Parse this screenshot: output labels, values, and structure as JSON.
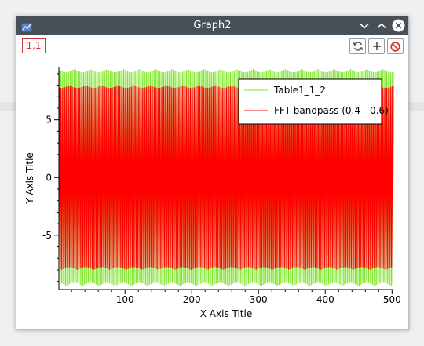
{
  "window": {
    "title": "Graph2",
    "layer_label": "1,1"
  },
  "icons": {
    "app": "graph-window-icon",
    "minimize": "chevron-down-icon",
    "maximize": "chevron-up-icon",
    "close": "close-circle-icon",
    "rescale": "rescale-refresh-icon",
    "add_layer": "plus-icon",
    "disable": "no-entry-icon"
  },
  "colors": {
    "titlebar": "#475057",
    "series_1": "#7fe52a",
    "series_2": "#ff0000",
    "layer_label": "#d13737"
  },
  "chart_data": {
    "type": "line",
    "xlabel": "X Axis Title",
    "ylabel": "Y Axis Title",
    "xlim": [
      1,
      502
    ],
    "ylim": [
      -9.7,
      9.6
    ],
    "xticks": [
      100,
      200,
      300,
      400,
      500
    ],
    "yticks": [
      -5,
      0,
      5
    ],
    "legend_position": "top-right",
    "series": [
      {
        "name": "Table1_1_2",
        "color": "#7fe52a",
        "amplitude_max": 9.4,
        "amplitude_min": -9.4,
        "form": "oscillation period ~2"
      },
      {
        "name": "FFT bandpass (0.4 - 0.6)",
        "color": "#ff0000",
        "amplitude_max": 8.0,
        "amplitude_min": -8.0,
        "form": "oscillation period ~2"
      }
    ]
  }
}
